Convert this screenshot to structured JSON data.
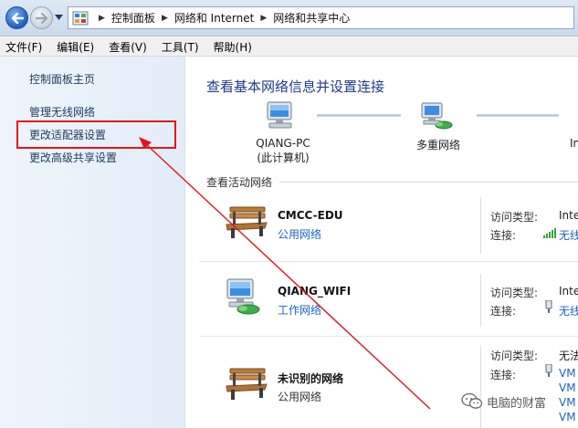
{
  "breadcrumb": [
    "控制面板",
    "网络和 Internet",
    "网络和共享中心"
  ],
  "menu": [
    "文件(F)",
    "编辑(E)",
    "查看(V)",
    "工具(T)",
    "帮助(H)"
  ],
  "sidebar": {
    "items": [
      "控制面板主页",
      "管理无线网络",
      "更改适配器设置",
      "更改高级共享设置"
    ],
    "highlighted_item": "更改适配器设置"
  },
  "main": {
    "title": "查看基本网络信息并设置连接",
    "map": {
      "this_pc": "QIANG-PC",
      "this_pc_sub": "(此计算机)",
      "middle": "多重网络",
      "right_partial": "In"
    },
    "active_label": "查看活动网络",
    "networks": [
      {
        "name": "CMCC-EDU",
        "type": "公用网络",
        "props": [
          {
            "label": "访问类型:",
            "value": "Inte"
          },
          {
            "label": "连接:",
            "value": "无线"
          }
        ]
      },
      {
        "name": "QIANG_WIFI",
        "type": "工作网络",
        "props": [
          {
            "label": "访问类型:",
            "value": "Inte"
          },
          {
            "label": "连接:",
            "value": "无线"
          }
        ]
      },
      {
        "name": "未识别的网络",
        "type": "公用网络",
        "props": [
          {
            "label": "访问类型:",
            "value": "无法"
          },
          {
            "label": "连接:",
            "value": "VM"
          }
        ],
        "extra_values": [
          "VM",
          "VM",
          "VM"
        ]
      }
    ]
  },
  "watermark": "电脑的财富",
  "colors": {
    "accent": "#1e3a8a",
    "link": "#1a63c6",
    "annotation": "#e3141b",
    "signal": "#2fa83a"
  },
  "icons": {
    "back": "back-arrow-icon",
    "forward": "forward-arrow-icon",
    "folder": "control-panel-icon",
    "computer": "computer-icon",
    "network": "network-icon",
    "bench": "park-bench-icon",
    "work": "work-network-icon",
    "signal": "wifi-signal-icon",
    "wechat": "wechat-icon"
  }
}
